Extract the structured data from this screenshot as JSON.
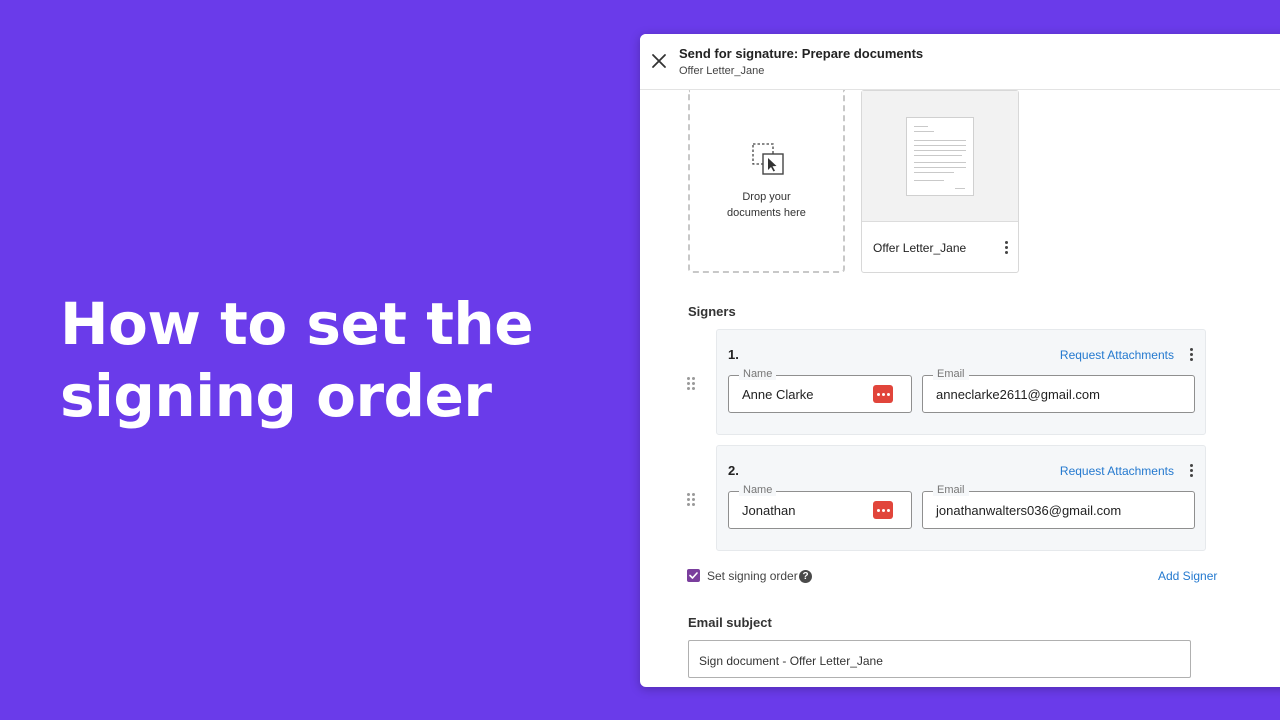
{
  "headline": {
    "line1": "How to set the",
    "line2": "signing order"
  },
  "dialog": {
    "title": "Send for signature: Prepare documents",
    "subtitle": "Offer Letter_Jane"
  },
  "drop_zone": {
    "line1": "Drop your",
    "line2": "documents here"
  },
  "document": {
    "name": "Offer Letter_Jane"
  },
  "signers_section": {
    "label": "Signers",
    "signers": [
      {
        "number": "1.",
        "request_attachments": "Request Attachments",
        "name_label": "Name",
        "name": "Anne Clarke",
        "email_label": "Email",
        "email": "anneclarke2611@gmail.com"
      },
      {
        "number": "2.",
        "request_attachments": "Request Attachments",
        "name_label": "Name",
        "name": "Jonathan",
        "email_label": "Email",
        "email": "jonathanwalters036@gmail.com"
      }
    ],
    "set_signing_order_label": "Set signing order",
    "set_signing_order_checked": true,
    "help_icon": "question-icon",
    "add_signer_label": "Add Signer"
  },
  "email_subject": {
    "label": "Email subject",
    "value": "Sign document - Offer Letter_Jane"
  },
  "colors": {
    "background": "#6a3bea",
    "link": "#2479cf",
    "checkbox": "#7a3e9d",
    "password_icon": "#e1453b"
  }
}
